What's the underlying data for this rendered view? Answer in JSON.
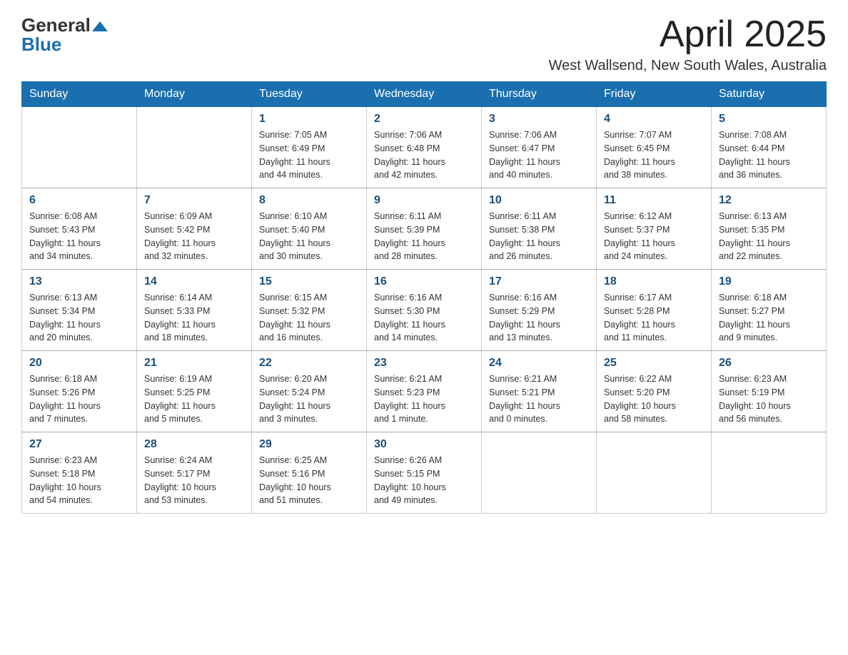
{
  "header": {
    "logo_general": "General",
    "logo_blue": "Blue",
    "month_title": "April 2025",
    "subtitle": "West Wallsend, New South Wales, Australia"
  },
  "days_of_week": [
    "Sunday",
    "Monday",
    "Tuesday",
    "Wednesday",
    "Thursday",
    "Friday",
    "Saturday"
  ],
  "weeks": [
    [
      {
        "day": "",
        "info": ""
      },
      {
        "day": "",
        "info": ""
      },
      {
        "day": "1",
        "info": "Sunrise: 7:05 AM\nSunset: 6:49 PM\nDaylight: 11 hours\nand 44 minutes."
      },
      {
        "day": "2",
        "info": "Sunrise: 7:06 AM\nSunset: 6:48 PM\nDaylight: 11 hours\nand 42 minutes."
      },
      {
        "day": "3",
        "info": "Sunrise: 7:06 AM\nSunset: 6:47 PM\nDaylight: 11 hours\nand 40 minutes."
      },
      {
        "day": "4",
        "info": "Sunrise: 7:07 AM\nSunset: 6:45 PM\nDaylight: 11 hours\nand 38 minutes."
      },
      {
        "day": "5",
        "info": "Sunrise: 7:08 AM\nSunset: 6:44 PM\nDaylight: 11 hours\nand 36 minutes."
      }
    ],
    [
      {
        "day": "6",
        "info": "Sunrise: 6:08 AM\nSunset: 5:43 PM\nDaylight: 11 hours\nand 34 minutes."
      },
      {
        "day": "7",
        "info": "Sunrise: 6:09 AM\nSunset: 5:42 PM\nDaylight: 11 hours\nand 32 minutes."
      },
      {
        "day": "8",
        "info": "Sunrise: 6:10 AM\nSunset: 5:40 PM\nDaylight: 11 hours\nand 30 minutes."
      },
      {
        "day": "9",
        "info": "Sunrise: 6:11 AM\nSunset: 5:39 PM\nDaylight: 11 hours\nand 28 minutes."
      },
      {
        "day": "10",
        "info": "Sunrise: 6:11 AM\nSunset: 5:38 PM\nDaylight: 11 hours\nand 26 minutes."
      },
      {
        "day": "11",
        "info": "Sunrise: 6:12 AM\nSunset: 5:37 PM\nDaylight: 11 hours\nand 24 minutes."
      },
      {
        "day": "12",
        "info": "Sunrise: 6:13 AM\nSunset: 5:35 PM\nDaylight: 11 hours\nand 22 minutes."
      }
    ],
    [
      {
        "day": "13",
        "info": "Sunrise: 6:13 AM\nSunset: 5:34 PM\nDaylight: 11 hours\nand 20 minutes."
      },
      {
        "day": "14",
        "info": "Sunrise: 6:14 AM\nSunset: 5:33 PM\nDaylight: 11 hours\nand 18 minutes."
      },
      {
        "day": "15",
        "info": "Sunrise: 6:15 AM\nSunset: 5:32 PM\nDaylight: 11 hours\nand 16 minutes."
      },
      {
        "day": "16",
        "info": "Sunrise: 6:16 AM\nSunset: 5:30 PM\nDaylight: 11 hours\nand 14 minutes."
      },
      {
        "day": "17",
        "info": "Sunrise: 6:16 AM\nSunset: 5:29 PM\nDaylight: 11 hours\nand 13 minutes."
      },
      {
        "day": "18",
        "info": "Sunrise: 6:17 AM\nSunset: 5:28 PM\nDaylight: 11 hours\nand 11 minutes."
      },
      {
        "day": "19",
        "info": "Sunrise: 6:18 AM\nSunset: 5:27 PM\nDaylight: 11 hours\nand 9 minutes."
      }
    ],
    [
      {
        "day": "20",
        "info": "Sunrise: 6:18 AM\nSunset: 5:26 PM\nDaylight: 11 hours\nand 7 minutes."
      },
      {
        "day": "21",
        "info": "Sunrise: 6:19 AM\nSunset: 5:25 PM\nDaylight: 11 hours\nand 5 minutes."
      },
      {
        "day": "22",
        "info": "Sunrise: 6:20 AM\nSunset: 5:24 PM\nDaylight: 11 hours\nand 3 minutes."
      },
      {
        "day": "23",
        "info": "Sunrise: 6:21 AM\nSunset: 5:23 PM\nDaylight: 11 hours\nand 1 minute."
      },
      {
        "day": "24",
        "info": "Sunrise: 6:21 AM\nSunset: 5:21 PM\nDaylight: 11 hours\nand 0 minutes."
      },
      {
        "day": "25",
        "info": "Sunrise: 6:22 AM\nSunset: 5:20 PM\nDaylight: 10 hours\nand 58 minutes."
      },
      {
        "day": "26",
        "info": "Sunrise: 6:23 AM\nSunset: 5:19 PM\nDaylight: 10 hours\nand 56 minutes."
      }
    ],
    [
      {
        "day": "27",
        "info": "Sunrise: 6:23 AM\nSunset: 5:18 PM\nDaylight: 10 hours\nand 54 minutes."
      },
      {
        "day": "28",
        "info": "Sunrise: 6:24 AM\nSunset: 5:17 PM\nDaylight: 10 hours\nand 53 minutes."
      },
      {
        "day": "29",
        "info": "Sunrise: 6:25 AM\nSunset: 5:16 PM\nDaylight: 10 hours\nand 51 minutes."
      },
      {
        "day": "30",
        "info": "Sunrise: 6:26 AM\nSunset: 5:15 PM\nDaylight: 10 hours\nand 49 minutes."
      },
      {
        "day": "",
        "info": ""
      },
      {
        "day": "",
        "info": ""
      },
      {
        "day": "",
        "info": ""
      }
    ]
  ]
}
